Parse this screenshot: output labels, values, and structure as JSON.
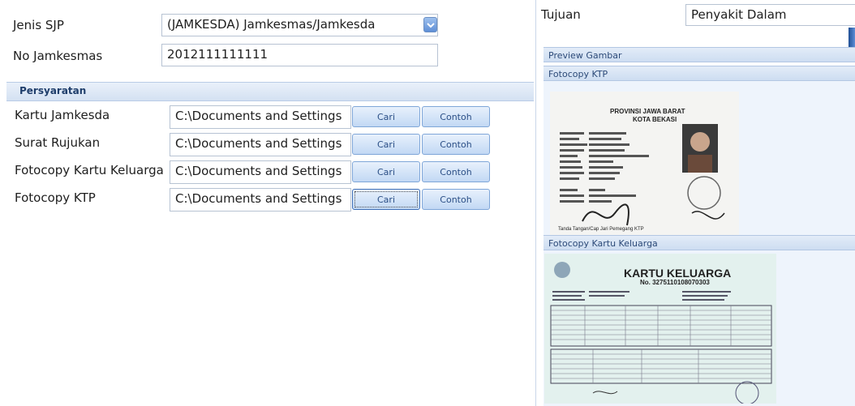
{
  "form": {
    "jenis_sjp_label": "Jenis SJP",
    "jenis_sjp_value": "(JAMKESDA) Jamkesmas/Jamkesda",
    "no_jamkesmas_label": "No Jamkesmas",
    "no_jamkesmas_value": "2012111111111"
  },
  "persyaratan": {
    "title": "Persyaratan",
    "rows": [
      {
        "label": "Kartu Jamkesda",
        "path": "C:\\Documents and Settings",
        "cari": "Cari",
        "contoh": "Contoh"
      },
      {
        "label": "Surat Rujukan",
        "path": "C:\\Documents and Settings",
        "cari": "Cari",
        "contoh": "Contoh"
      },
      {
        "label": "Fotocopy Kartu Keluarga",
        "path": "C:\\Documents and Settings",
        "cari": "Cari",
        "contoh": "Contoh"
      },
      {
        "label": "Fotocopy KTP",
        "path": "C:\\Documents and Settings",
        "cari": "Cari",
        "contoh": "Contoh"
      }
    ]
  },
  "tujuan": {
    "label": "Tujuan",
    "value": "Penyakit Dalam"
  },
  "preview": {
    "title": "Preview Gambar",
    "ktp_title": "Fotocopy KTP",
    "kk_title": "Fotocopy Kartu Keluarga"
  },
  "ktp_doc": {
    "province": "PROVINSI JAWA BARAT",
    "city": "KOTA BEKASI",
    "signature_label": "Tanda Tangan/Cap Jari Pemegang KTP"
  },
  "kk_doc": {
    "title": "KARTU KELUARGA",
    "number": "No. 3275110108070303"
  },
  "icons": {
    "dropdown": "chevron-down-icon"
  },
  "colors": {
    "accent": "#5f8fd6",
    "section_bg": "#d4e1f2",
    "button_bg": "#c2d8f4"
  }
}
